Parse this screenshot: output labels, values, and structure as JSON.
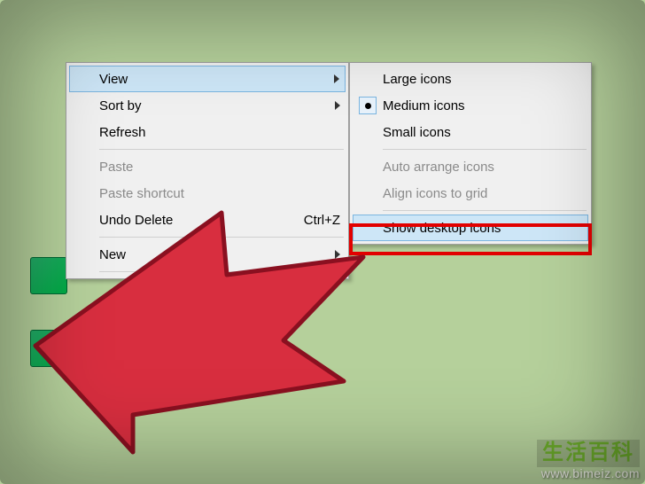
{
  "main_menu": {
    "view": "View",
    "sort_by": "Sort by",
    "refresh": "Refresh",
    "paste": "Paste",
    "paste_shortcut": "Paste shortcut",
    "undo_delete": "Undo Delete",
    "undo_delete_shortcut": "Ctrl+Z",
    "new": "New"
  },
  "sub_menu": {
    "large_icons": "Large icons",
    "medium_icons": "Medium icons",
    "small_icons": "Small icons",
    "auto_arrange": "Auto arrange icons",
    "align_grid": "Align icons to grid",
    "show_desktop_icons": "Show desktop icons"
  },
  "watermark": {
    "text_cn": "生活百科",
    "url": "www.bimeiz.com"
  },
  "colors": {
    "highlight_bg": "#cde6f7",
    "highlight_border": "#7bb5e0",
    "arrow_fill": "#d82e3f",
    "arrow_stroke": "#8a1020",
    "outline": "#e20000"
  }
}
